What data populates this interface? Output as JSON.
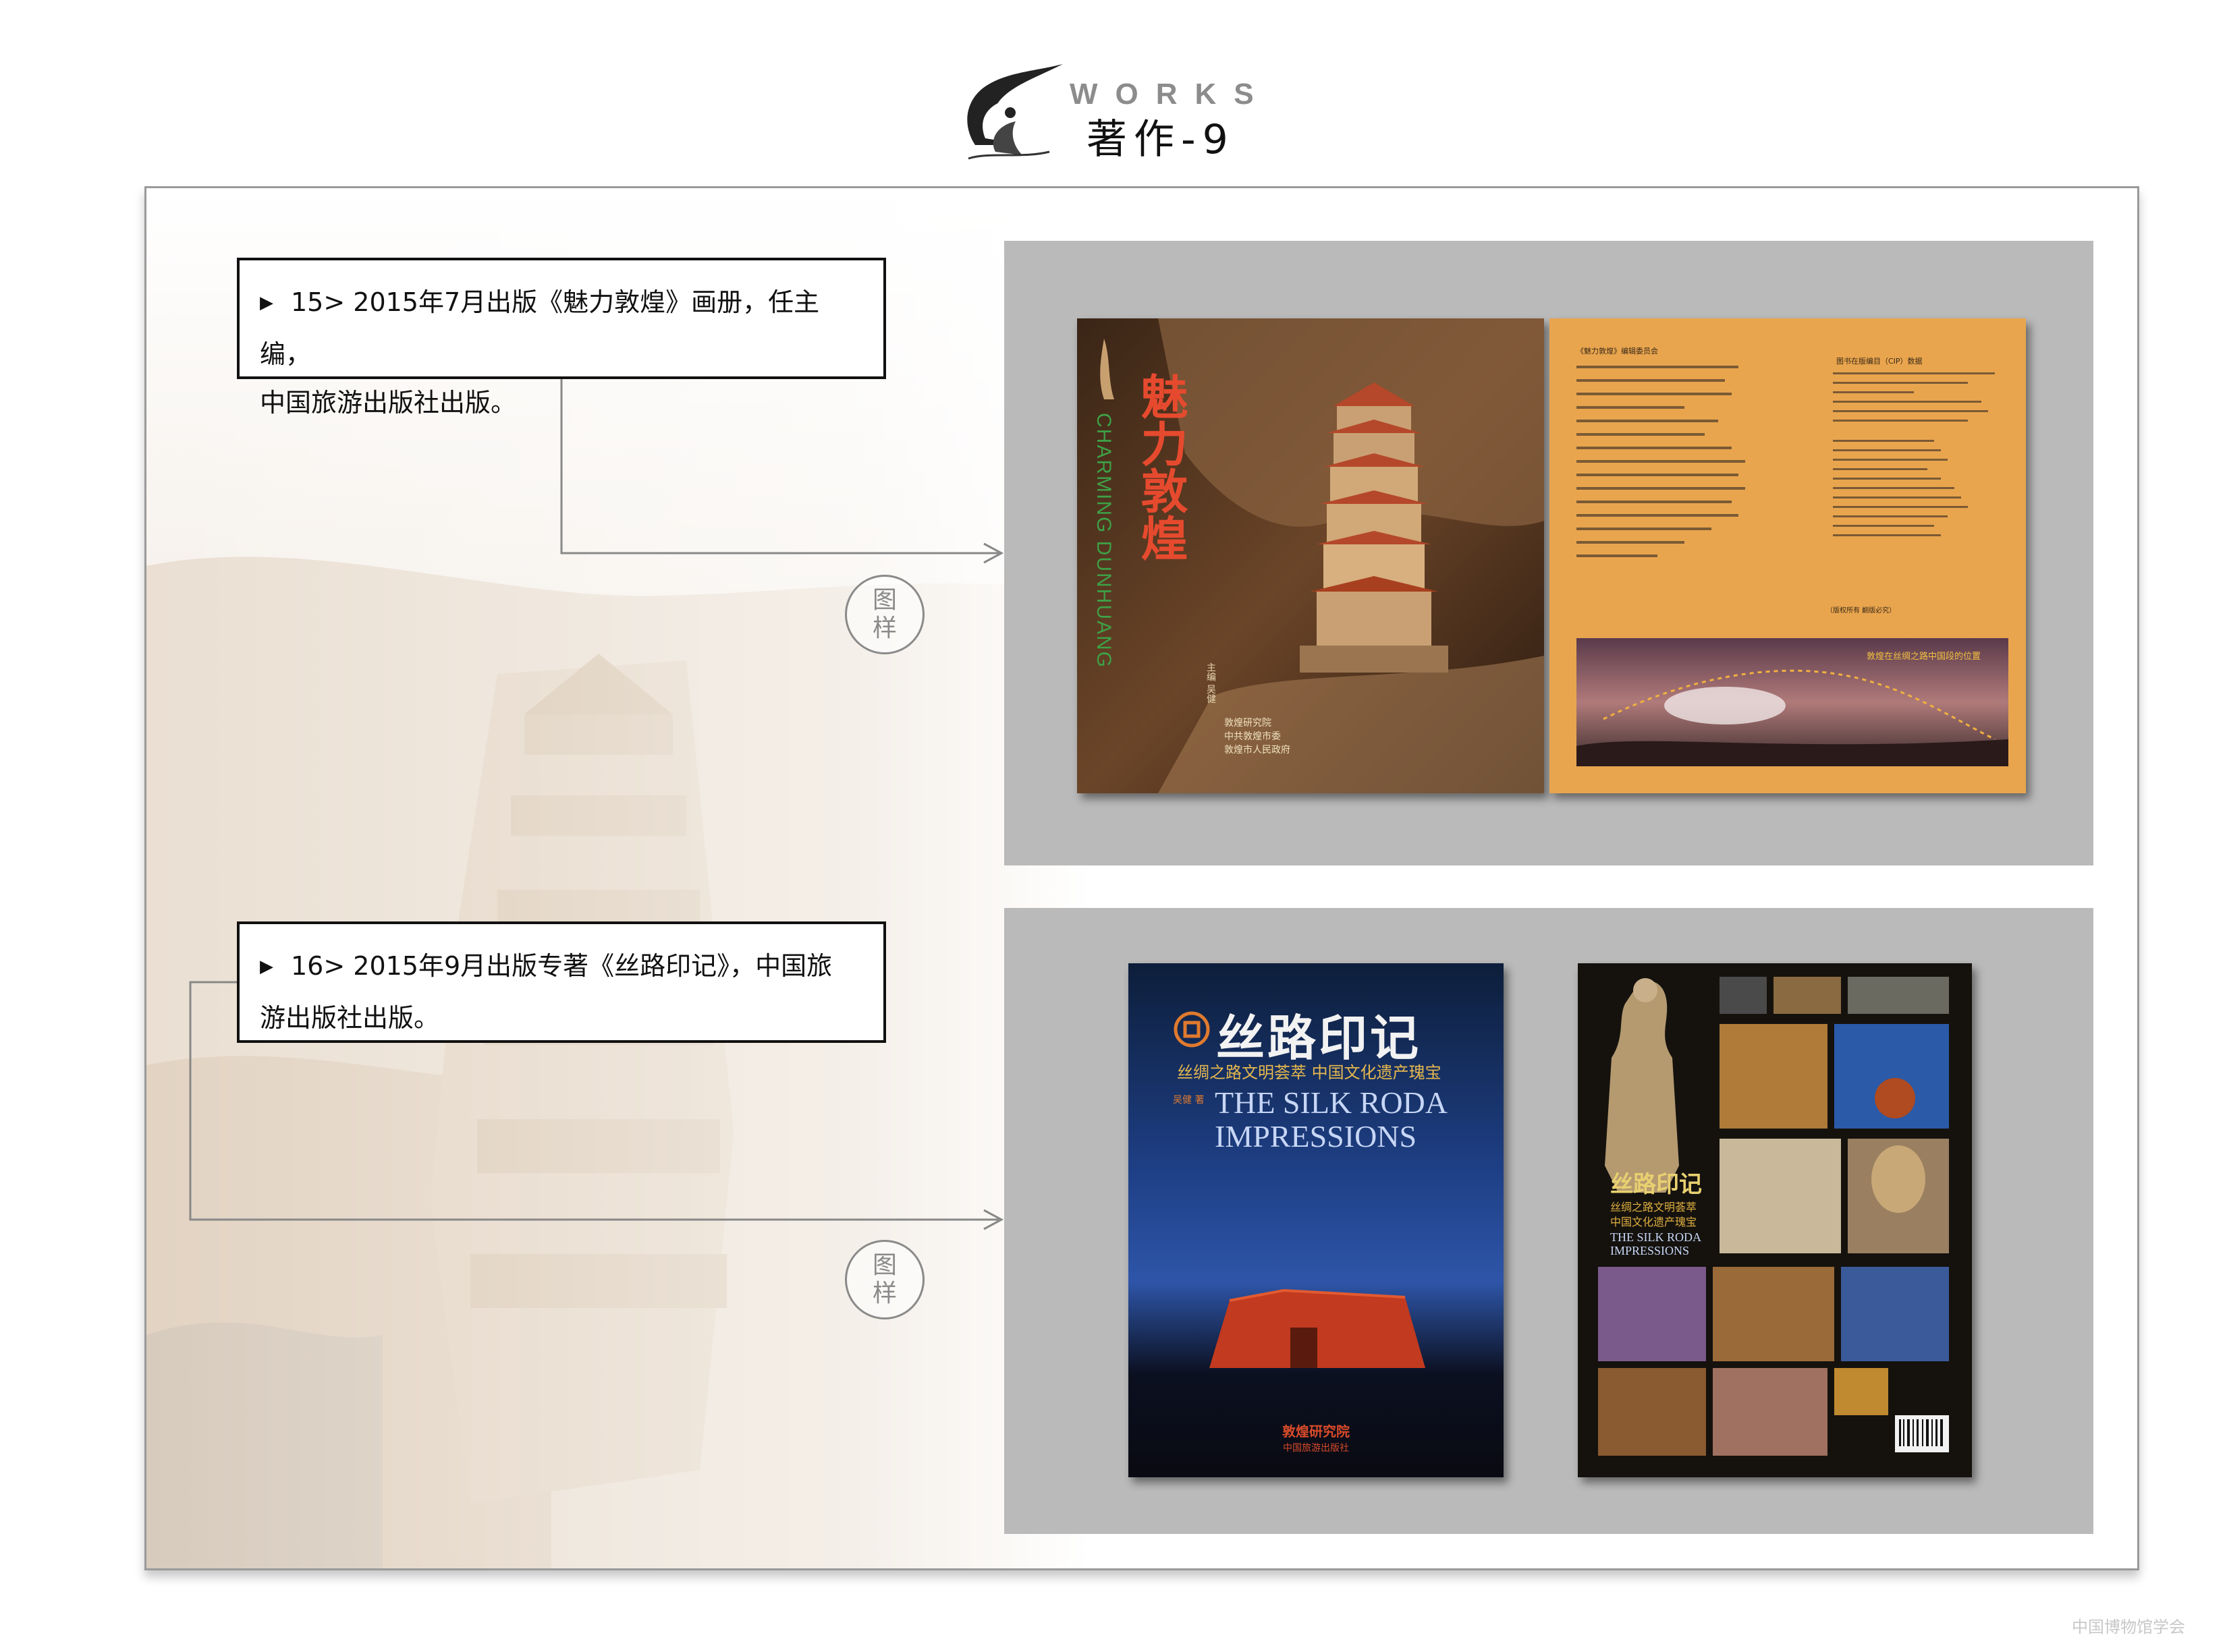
{
  "header": {
    "works_label": "WORKS",
    "title": "著作-9"
  },
  "items": [
    {
      "line1": "15> 2015年7月出版《魅力敦煌》画册，任主编，",
      "line2": "中国旅游出版社出版。",
      "stamp": [
        "图",
        "样"
      ]
    },
    {
      "line1": "16> 2015年9月出版专著《丝路印记》，中国旅",
      "line2": "游出版社出版。",
      "stamp": [
        "图",
        "样"
      ]
    }
  ],
  "book1": {
    "cover_title": "魅力敦煌",
    "cover_pinyin": "CHARMING DUNHUANG",
    "cover_author": "主编 吴健",
    "cover_publishers": [
      "敦煌研究院",
      "中共敦煌市委",
      "敦煌市人民政府"
    ],
    "spread_committee_title": "《魅力敦煌》编辑委员会",
    "spread_cip_title": "图书在版编目（CIP）数据",
    "spread_map_caption": "敦煌在丝绸之路中国段的位置",
    "spread_footer": "（版权所有 翻版必究）"
  },
  "book2": {
    "cover_title": "丝路印记",
    "cover_subtitle": "丝绸之路文明荟萃   中国文化遗产瑰宝",
    "cover_author": "吴健 著",
    "cover_en1": "THE SILK RODA",
    "cover_en2": "IMPRESSIONS",
    "cover_publisher1": "敦煌研究院",
    "cover_publisher2": "中国旅游出版社",
    "back_title": "丝路印记",
    "back_sub1": "丝绸之路文明荟萃",
    "back_sub2": "中国文化遗产瑰宝",
    "back_en1": "THE SILK RODA",
    "back_en2": "IMPRESSIONS"
  },
  "watermark": "中国博物馆学会"
}
